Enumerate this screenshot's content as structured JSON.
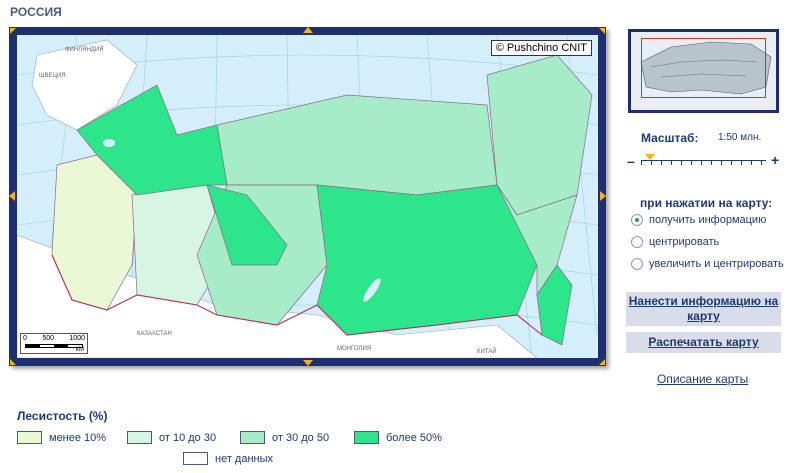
{
  "page": {
    "title": "РОССИЯ"
  },
  "map": {
    "copyright": "© Pushchino CNIT",
    "scalebar": {
      "ticks": [
        "0",
        "500",
        "1000"
      ],
      "unit": "КМ"
    },
    "labels": [
      "ФИНЛЯНДИЯ",
      "ШВЕЦИЯ",
      "КАЗАХСТАН",
      "МОНГОЛИЯ",
      "КИТАЙ"
    ]
  },
  "scale": {
    "title": "Масштаб:",
    "value": "1:50 млн.",
    "minus": "–",
    "plus": "+"
  },
  "click_action": {
    "title": "при нажатии на карту:",
    "options": [
      {
        "label": "получить информацию",
        "selected": true
      },
      {
        "label": "центрировать",
        "selected": false
      },
      {
        "label": "увеличить и центрировать",
        "selected": false
      }
    ]
  },
  "buttons": {
    "add_info": "Нанести информацию на карту",
    "print": "Распечатать карту"
  },
  "links": {
    "map_description": "Описание карты"
  },
  "legend": {
    "title": "Лесистость (%)",
    "items": [
      {
        "label": "менее 10%",
        "color": "#eaf8d6"
      },
      {
        "label": "от 10 до 30",
        "color": "#d6f5e2"
      },
      {
        "label": "от 30 до 50",
        "color": "#a6ecc8"
      },
      {
        "label": "более 50%",
        "color": "#2de58a"
      },
      {
        "label": "нет данных",
        "color": "#ffffff"
      }
    ]
  },
  "colors": {
    "frame": "#1f2f6e",
    "water": "#d5eefb",
    "accent": "#f2b21b",
    "text": "#1f3a6e"
  }
}
